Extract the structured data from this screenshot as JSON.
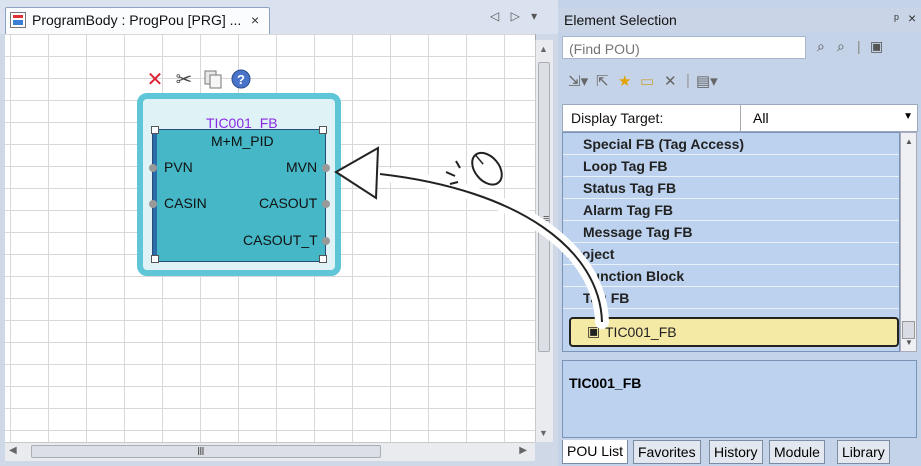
{
  "editor": {
    "tab_title": "ProgramBody : ProgPou [PRG] ...",
    "tab_close": "×",
    "nav_arrows": "◁ ▷ ▾"
  },
  "fb": {
    "instance_name": "TIC001_FB",
    "type_name": "M+M_PID",
    "inputs": [
      "PVN",
      "CASIN"
    ],
    "outputs": [
      "MVN",
      "CASOUT",
      "CASOUT_T"
    ],
    "toolbar_icons": [
      "delete-icon",
      "cut-icon",
      "copy-icon",
      "help-icon"
    ]
  },
  "panel": {
    "title": "Element Selection",
    "pin": "ᵖ",
    "close": "×",
    "find_placeholder": "(Find POU)",
    "display_target_label": "Display Target:",
    "display_target_value": "All",
    "tree_items": [
      {
        "label": "Special FB (Tag Access)",
        "indent": 1
      },
      {
        "label": "Loop Tag FB",
        "indent": 1
      },
      {
        "label": "Status Tag FB",
        "indent": 1
      },
      {
        "label": "Alarm Tag FB",
        "indent": 1
      },
      {
        "label": "Message Tag FB",
        "indent": 1
      },
      {
        "label": "Project",
        "indent": 0
      },
      {
        "label": "Function Block",
        "indent": 1
      },
      {
        "label": "Tag FB",
        "indent": 1
      }
    ],
    "selected_item": "TIC001_FB",
    "info_name": "TIC001_FB",
    "bottom_tabs": [
      "POU List",
      "Favorites",
      "History",
      "Module",
      "Library"
    ],
    "active_tab": "POU List"
  },
  "colors": {
    "fb_fill": "#45b7c6",
    "fb_selection": "#5ec6d6",
    "fb_title": "#8a2be2",
    "selected_row": "#f5e9a6"
  }
}
